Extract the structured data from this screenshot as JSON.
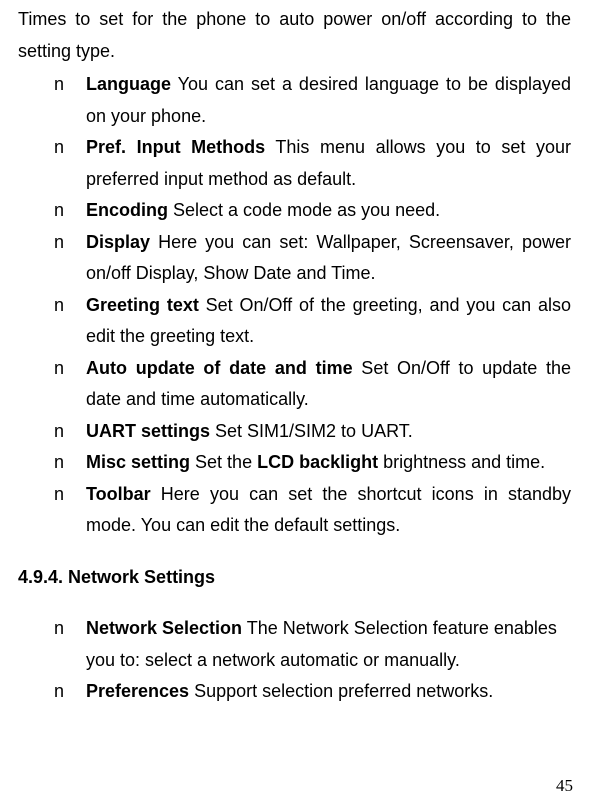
{
  "intro": "Times to set for the phone to auto power on/off   according to the setting type.",
  "items1": [
    {
      "label": "Language",
      "desc": "    You can set a desired language to be displayed on your phone."
    },
    {
      "label": "Pref. Input Methods",
      "desc": "    This menu allows you to set your preferred input method as default."
    },
    {
      "label": "Encoding",
      "desc": " Select a code mode as you need."
    },
    {
      "label": "Display",
      "desc": " Here you can set: Wallpaper, Screensaver, power on/off Display, Show Date and Time."
    },
    {
      "label": "Greeting text",
      "desc": " Set On/Off of the greeting, and you can also edit the greeting text."
    },
    {
      "label": "Auto update of date and time",
      "desc": " Set On/Off to update the date and time automatically."
    },
    {
      "label": "UART settings",
      "desc": " Set SIM1/SIM2 to UART."
    },
    {
      "label": "Misc setting",
      "desc_pre": " Set the ",
      "label2": "LCD backlight",
      "desc_post": " brightness and time."
    },
    {
      "label": "Toolbar",
      "desc": " Here you can set the shortcut icons in standby mode. You can edit the default settings."
    }
  ],
  "section_heading": "4.9.4.   Network Settings",
  "items2": [
    {
      "label": "Network Selection",
      "desc": " The Network Selection feature enables you to: select a network automatic or manually."
    },
    {
      "label": "Preferences",
      "desc": " Support selection preferred networks."
    }
  ],
  "bullet": "n",
  "page_number": "45"
}
